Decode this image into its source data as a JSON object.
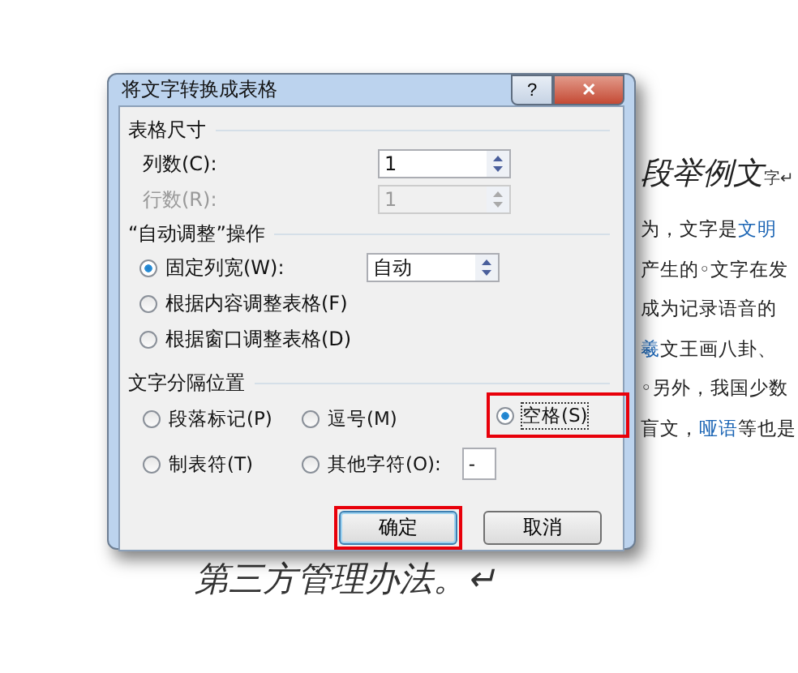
{
  "document": {
    "heading": "段举例文",
    "heading_tail": "字↵",
    "lines": [
      {
        "text": "为，文字是**文明**"
      },
      {
        "text": "产生的◦文字在发"
      },
      {
        "text": "成为记录语音的"
      },
      {
        "text": "**羲**文王画八卦、"
      },
      {
        "text": "◦另外，我国少数"
      },
      {
        "text": "盲文，**哑语**等也是"
      }
    ],
    "bottom_line": "第三方管理办法。↵"
  },
  "dialog": {
    "title": "将文字转换成表格",
    "help": "?",
    "close": "✕",
    "size_group": {
      "title": "表格尺寸",
      "fields": [
        {
          "label": "列数(C):",
          "value": "1",
          "disabled": false
        },
        {
          "label": "行数(R):",
          "value": "1",
          "disabled": true
        }
      ]
    },
    "autofit_group": {
      "title": "“自动调整”操作",
      "options": [
        {
          "label": "固定列宽(W):",
          "selected": true,
          "value": "自动"
        },
        {
          "label": "根据内容调整表格(F)",
          "selected": false
        },
        {
          "label": "根据窗口调整表格(D)",
          "selected": false
        }
      ]
    },
    "separator_group": {
      "title": "文字分隔位置",
      "options": [
        {
          "label": "段落标记(P)",
          "selected": false,
          "highlighted": false
        },
        {
          "label": "逗号(M)",
          "selected": false,
          "highlighted": false
        },
        {
          "label": "空格(S)",
          "selected": true,
          "highlighted": true
        },
        {
          "label": "制表符(T)",
          "selected": false,
          "highlighted": false
        },
        {
          "label": "其他字符(O):",
          "selected": false,
          "highlighted": false,
          "value": "-"
        }
      ]
    },
    "buttons": [
      {
        "label": "确定",
        "default": true,
        "highlighted": true
      },
      {
        "label": "取消",
        "default": false,
        "highlighted": false
      }
    ]
  }
}
